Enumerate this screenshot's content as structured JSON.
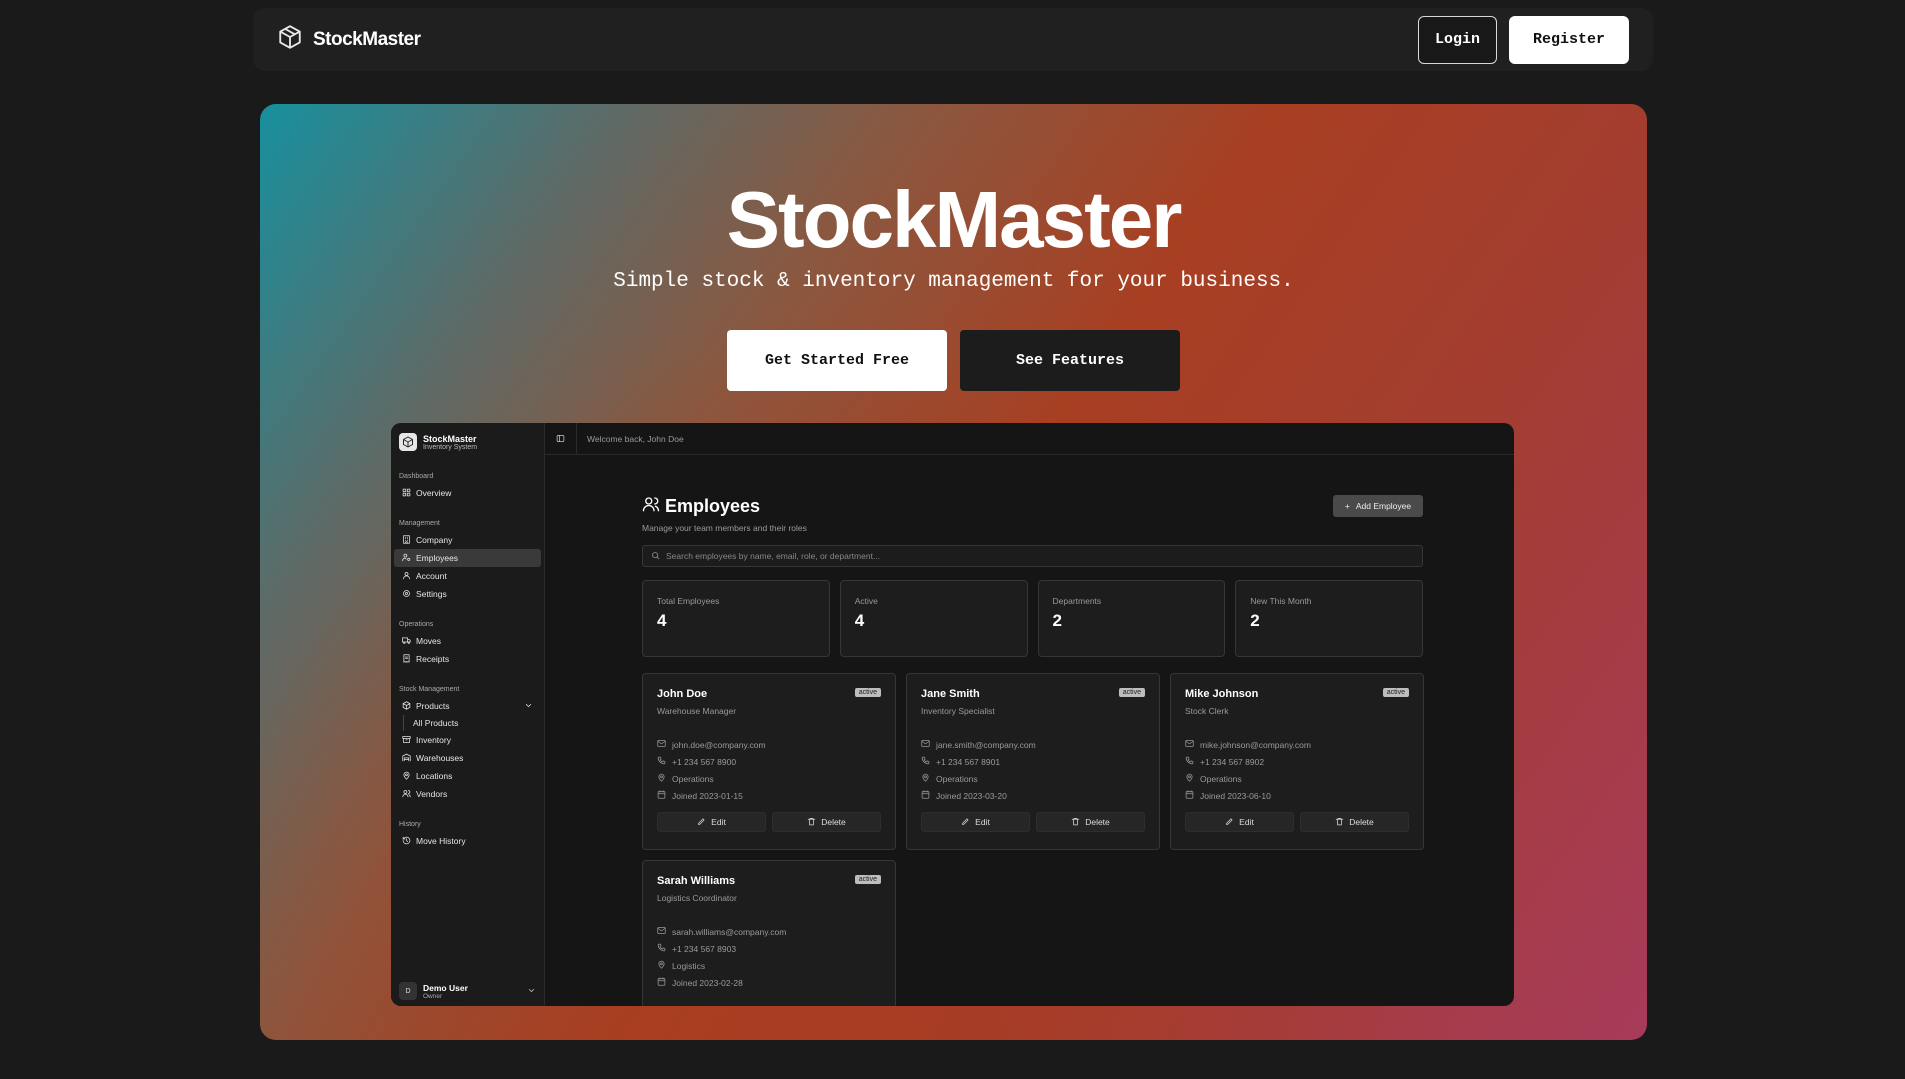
{
  "nav": {
    "brand": "StockMaster",
    "login": "Login",
    "register": "Register"
  },
  "hero": {
    "title": "StockMaster",
    "subtitle": "Simple stock & inventory management for your business.",
    "cta_primary": "Get Started Free",
    "cta_secondary": "See Features"
  },
  "app": {
    "sidebar": {
      "title": "StockMaster",
      "subtitle": "Inventory System",
      "groups": {
        "dashboard": "Dashboard",
        "management": "Management",
        "operations": "Operations",
        "stock": "Stock Management",
        "history": "History"
      },
      "items": {
        "overview": "Overview",
        "company": "Company",
        "employees": "Employees",
        "account": "Account",
        "settings": "Settings",
        "moves": "Moves",
        "receipts": "Receipts",
        "products": "Products",
        "all_products": "All Products",
        "inventory": "Inventory",
        "warehouses": "Warehouses",
        "locations": "Locations",
        "vendors": "Vendors",
        "move_history": "Move History"
      },
      "user": {
        "initials": "D",
        "name": "Demo User",
        "role": "Owner"
      }
    },
    "topbar": {
      "welcome": "Welcome back, John Doe"
    },
    "page": {
      "title": "Employees",
      "subtitle": "Manage your team members and their roles",
      "add_button": "Add Employee",
      "search_placeholder": "Search employees by name, email, role, or department..."
    },
    "stats": [
      {
        "label": "Total Employees",
        "value": "4"
      },
      {
        "label": "Active",
        "value": "4"
      },
      {
        "label": "Departments",
        "value": "2"
      },
      {
        "label": "New This Month",
        "value": "2"
      }
    ],
    "employees": [
      {
        "name": "John Doe",
        "status": "active",
        "role": "Warehouse Manager",
        "email": "john.doe@company.com",
        "phone": "+1 234 567 8900",
        "department": "Operations",
        "joined": "Joined 2023-01-15"
      },
      {
        "name": "Jane Smith",
        "status": "active",
        "role": "Inventory Specialist",
        "email": "jane.smith@company.com",
        "phone": "+1 234 567 8901",
        "department": "Operations",
        "joined": "Joined 2023-03-20"
      },
      {
        "name": "Mike Johnson",
        "status": "active",
        "role": "Stock Clerk",
        "email": "mike.johnson@company.com",
        "phone": "+1 234 567 8902",
        "department": "Operations",
        "joined": "Joined 2023-06-10"
      },
      {
        "name": "Sarah Williams",
        "status": "active",
        "role": "Logistics Coordinator",
        "email": "sarah.williams@company.com",
        "phone": "+1 234 567 8903",
        "department": "Logistics",
        "joined": "Joined 2023-02-28"
      }
    ],
    "card_actions": {
      "edit": "Edit",
      "delete": "Delete"
    }
  }
}
